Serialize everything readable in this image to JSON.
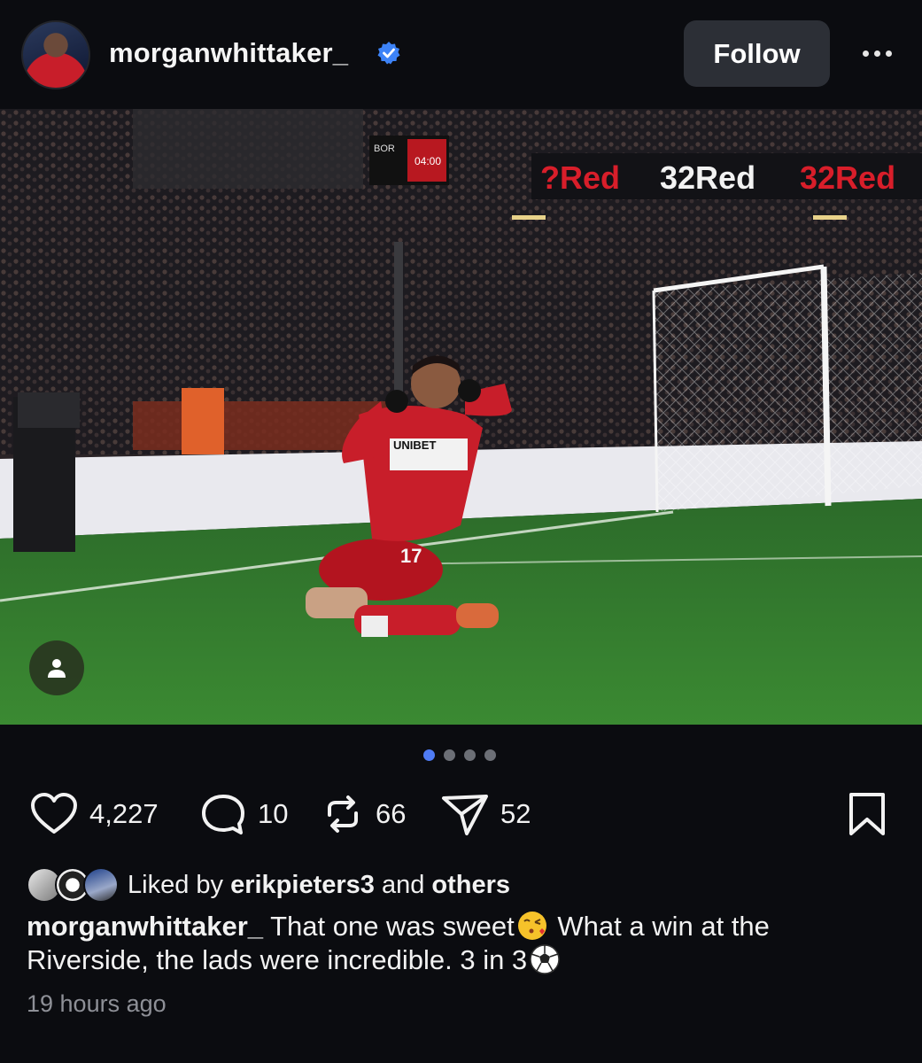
{
  "header": {
    "username": "morganwhittaker_",
    "follow_label": "Follow"
  },
  "photo": {
    "ad_board_text": "32Red",
    "scoreboard_text": "BOR 1 04:00",
    "shirt_sponsor": "UNIBET",
    "shirt_number": "17"
  },
  "carousel": {
    "total": 4,
    "active": 1
  },
  "actions": {
    "likes": "4,227",
    "comments": "10",
    "reposts": "66",
    "shares": "52"
  },
  "liked_by": {
    "prefix": "Liked by",
    "user": "erikpieters3",
    "connector": "and",
    "others": "others"
  },
  "caption": {
    "author": "morganwhittaker_",
    "text_part1": "That one was sweet",
    "text_part2": "What a win at the Riverside, the lads were incredible. 3 in 3",
    "emoji_1": "kissing-face-emoji",
    "emoji_2": "soccer-ball-emoji"
  },
  "timestamp": "19 hours ago",
  "colors": {
    "background": "#0b0c10",
    "follow_button": "#2c2f36",
    "verified_blue": "#3d83f7",
    "dot_active": "#4f7cf5",
    "kit_red": "#c81e2a",
    "pitch_green": "#2f7a2a"
  }
}
